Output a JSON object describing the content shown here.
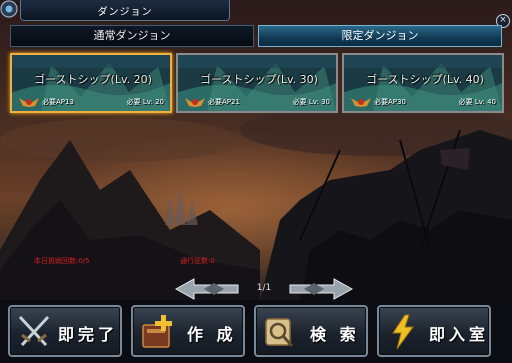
{
  "window": {
    "title": "ダンジョン",
    "close_label": "×"
  },
  "tabs": [
    {
      "label": "通常ダンジョン",
      "active": false
    },
    {
      "label": "限定ダンジョン",
      "active": true
    }
  ],
  "cards": [
    {
      "name": "ゴーストシップ(Lv. 20)",
      "ap": "必要AP13",
      "lv": "必要 Lv: 20",
      "selected": true
    },
    {
      "name": "ゴーストシップ(Lv. 30)",
      "ap": "必要AP21",
      "lv": "必要 Lv: 30",
      "selected": false
    },
    {
      "name": "ゴーストシップ(Lv. 40)",
      "ap": "必要AP30",
      "lv": "必要 Lv: 40",
      "selected": false
    }
  ],
  "status": {
    "daily": "本日挑戦回数:0/5",
    "clear": "通行証数:0"
  },
  "pager": {
    "text": "1/1"
  },
  "buttons": [
    {
      "label": "即完了",
      "icon": "crossed-swords-icon"
    },
    {
      "label": "作 成",
      "icon": "spellbook-plus-icon"
    },
    {
      "label": "検 索",
      "icon": "scroll-magnifier-icon"
    },
    {
      "label": "即入室",
      "icon": "lightning-icon"
    }
  ],
  "colors": {
    "accent_gold": "#f0b040",
    "status_red": "#d42020",
    "tab_active": "#2a6a8a"
  }
}
